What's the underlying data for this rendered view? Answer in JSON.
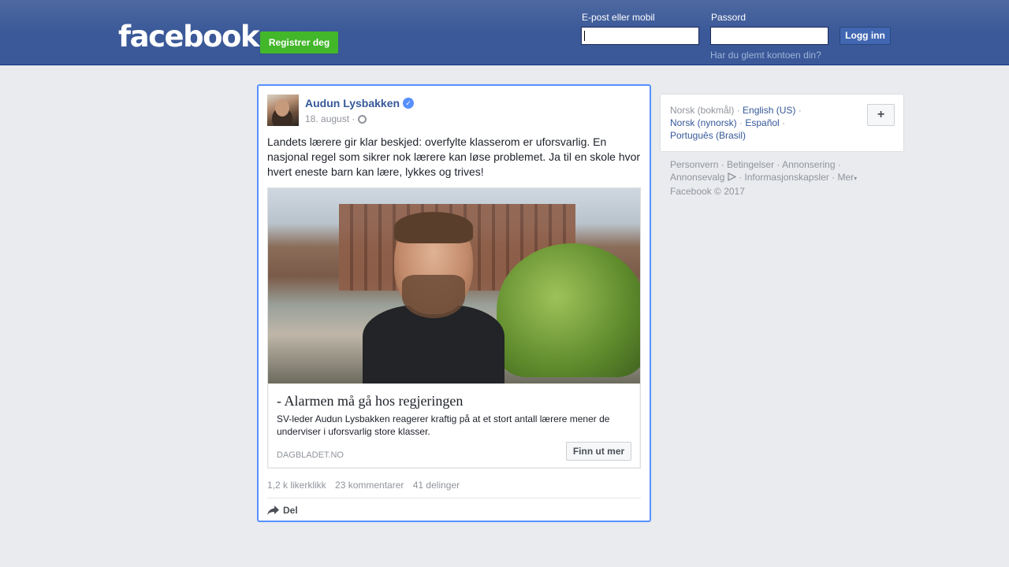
{
  "header": {
    "logo": "facebook",
    "register_label": "Registrer deg",
    "email_label": "E-post eller mobil",
    "email_value": "",
    "password_label": "Passord",
    "password_value": "",
    "login_label": "Logg inn",
    "forgot_label": "Har du glemt kontoen din?",
    "colors": {
      "bar": "#3b5998",
      "register": "#42b72a",
      "login": "#4267b2"
    }
  },
  "post": {
    "author": "Audun Lysbakken",
    "verified_icon": "verified-check-icon",
    "date": "18. august ·",
    "privacy_icon": "globe-icon",
    "text": "Landets lærere gir klar beskjed: overfylte klasserom er uforsvarlig. En nasjonal regel som sikrer nok lærere kan løse problemet. Ja til en skole hvor hvert eneste barn kan lære, lykkes og trives!",
    "link": {
      "title": "- Alarmen må gå hos regjeringen",
      "description": "SV-leder Audun Lysbakken reagerer kraftig på at et stort antall lærere mener de underviser i uforsvarlig store klasser.",
      "domain": "DAGBLADET.NO",
      "cta_label": "Finn ut mer"
    },
    "stats": {
      "likes": "1,2 k likerklikk",
      "comments": "23 kommentarer",
      "shares": "41 delinger"
    },
    "share_label": "Del",
    "accent": "#5890ff"
  },
  "sidebar": {
    "languages": {
      "current": "Norsk (bokmål)",
      "sep": " · ",
      "items": [
        "English (US)",
        "Norsk (nynorsk)",
        "Español",
        "Português (Brasil)"
      ],
      "more_label": "+"
    },
    "footer": {
      "links": [
        "Personvern",
        "Betingelser",
        "Annonsering",
        "Annonsevalg",
        "Informasjonskapsler",
        "Mer"
      ],
      "copyright": "Facebook © 2017"
    }
  }
}
